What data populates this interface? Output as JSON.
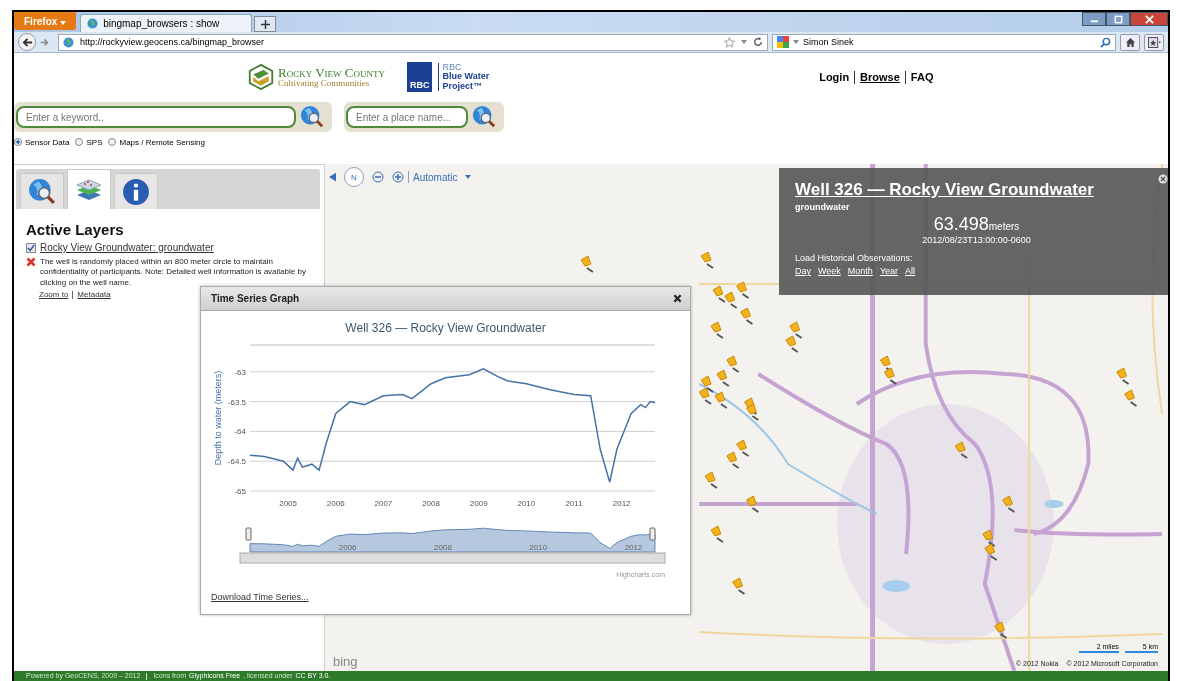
{
  "browser": {
    "menu_button": "Firefox",
    "tab": {
      "title": "bingmap_browsers : show"
    },
    "url": "http://rockyview.geocens.ca/bingmap_browser",
    "search_value": "Simon Sinek"
  },
  "header": {
    "logo_title": "Rocky View County",
    "logo_subtitle": "Cultivating Communities",
    "partner_mark": "RBC",
    "partner_lines": [
      "RBC",
      "Blue Water",
      "Project™"
    ],
    "nav": [
      {
        "label": "Login",
        "selected": false
      },
      {
        "label": "Browse",
        "selected": true
      },
      {
        "label": "FAQ",
        "selected": false
      }
    ]
  },
  "search": {
    "keyword_placeholder": "Enter a keyword..",
    "place_placeholder": "Enter a place name...",
    "sources": [
      {
        "label": "Sensor Data",
        "selected": true
      },
      {
        "label": "SPS",
        "selected": false
      },
      {
        "label": "Maps / Remote Sensing",
        "selected": false
      }
    ]
  },
  "sidebar": {
    "tabs": [
      {
        "kind": "search",
        "selected": false
      },
      {
        "kind": "layers",
        "selected": true
      },
      {
        "kind": "info",
        "selected": false
      }
    ],
    "heading": "Active Layers",
    "layers": [
      {
        "name": "Rocky View Groundwater: groundwater",
        "checked": true,
        "note": "The well is randomly placed within an 800 meter circle to maintain confidentiality of participants. Note: Detailed well information is available by clicking on the well name.",
        "links": [
          "Zoom to",
          "Metadata"
        ]
      }
    ]
  },
  "map": {
    "compass": "N",
    "style": "Automatic",
    "brand": "bing",
    "scale": [
      "2 miles",
      "5 km"
    ],
    "copyright": [
      "© 2012 Nokia",
      "© 2012 Microsoft Corporation"
    ]
  },
  "popup": {
    "title": "Well 326 — Rocky View Groundwater",
    "subtitle": "groundwater",
    "value": "63.498",
    "unit": "meters",
    "time": "2012/08/23T13:00:00-0600",
    "history_label": "Load Historical Observations:",
    "history_links": [
      "Day",
      "Week",
      "Month",
      "Year",
      "All"
    ]
  },
  "graph": {
    "title": "Time Series Graph",
    "chart_data": {
      "type": "line",
      "title": "Well 326 — Rocky View Groundwater",
      "ylabel": "Depth to water (meters)",
      "x": [
        2004.2,
        2004.5,
        2004.9,
        2005.1,
        2005.2,
        2005.3,
        2005.5,
        2005.65,
        2005.8,
        2006.0,
        2006.3,
        2006.6,
        2007.0,
        2007.4,
        2007.6,
        2008.0,
        2008.3,
        2008.8,
        2009.1,
        2009.4,
        2009.6,
        2010.0,
        2010.5,
        2011.0,
        2011.35,
        2011.55,
        2011.75,
        2011.9,
        2012.2,
        2012.4,
        2012.5,
        2012.6,
        2012.7
      ],
      "series": [
        {
          "color": "#4572a7",
          "values": [
            -64.4,
            -64.42,
            -64.5,
            -64.65,
            -64.45,
            -64.6,
            -64.55,
            -64.65,
            -64.2,
            -63.7,
            -63.5,
            -63.55,
            -63.4,
            -63.38,
            -63.45,
            -63.2,
            -63.1,
            -63.05,
            -62.95,
            -63.08,
            -63.15,
            -63.2,
            -63.3,
            -63.38,
            -63.4,
            -64.3,
            -64.85,
            -64.3,
            -63.7,
            -63.55,
            -63.6,
            -63.5,
            -63.52
          ]
        }
      ],
      "xlim": [
        2004.2,
        2012.7
      ],
      "ylim": [
        -65,
        -62.55
      ],
      "xticks": [
        2005,
        2006,
        2007,
        2008,
        2009,
        2010,
        2011,
        2012
      ],
      "yticks": [
        -63,
        -63.5,
        -64,
        -64.5,
        -65
      ],
      "grid": true
    },
    "navigator_labels": [
      "2006",
      "2008",
      "2010",
      "2012"
    ],
    "credit": "Highcharts.com",
    "download": "Download Time Series..."
  },
  "footer": {
    "credit": "Powered by GeoCENS, 2009 – 2012",
    "parts": [
      {
        "kind": "text",
        "text": "Icons from"
      },
      {
        "kind": "link",
        "text": "Glyphicons Free"
      },
      {
        "kind": "text",
        "text": ", licensed under"
      },
      {
        "kind": "link",
        "text": "CC BY 3.0."
      }
    ]
  }
}
